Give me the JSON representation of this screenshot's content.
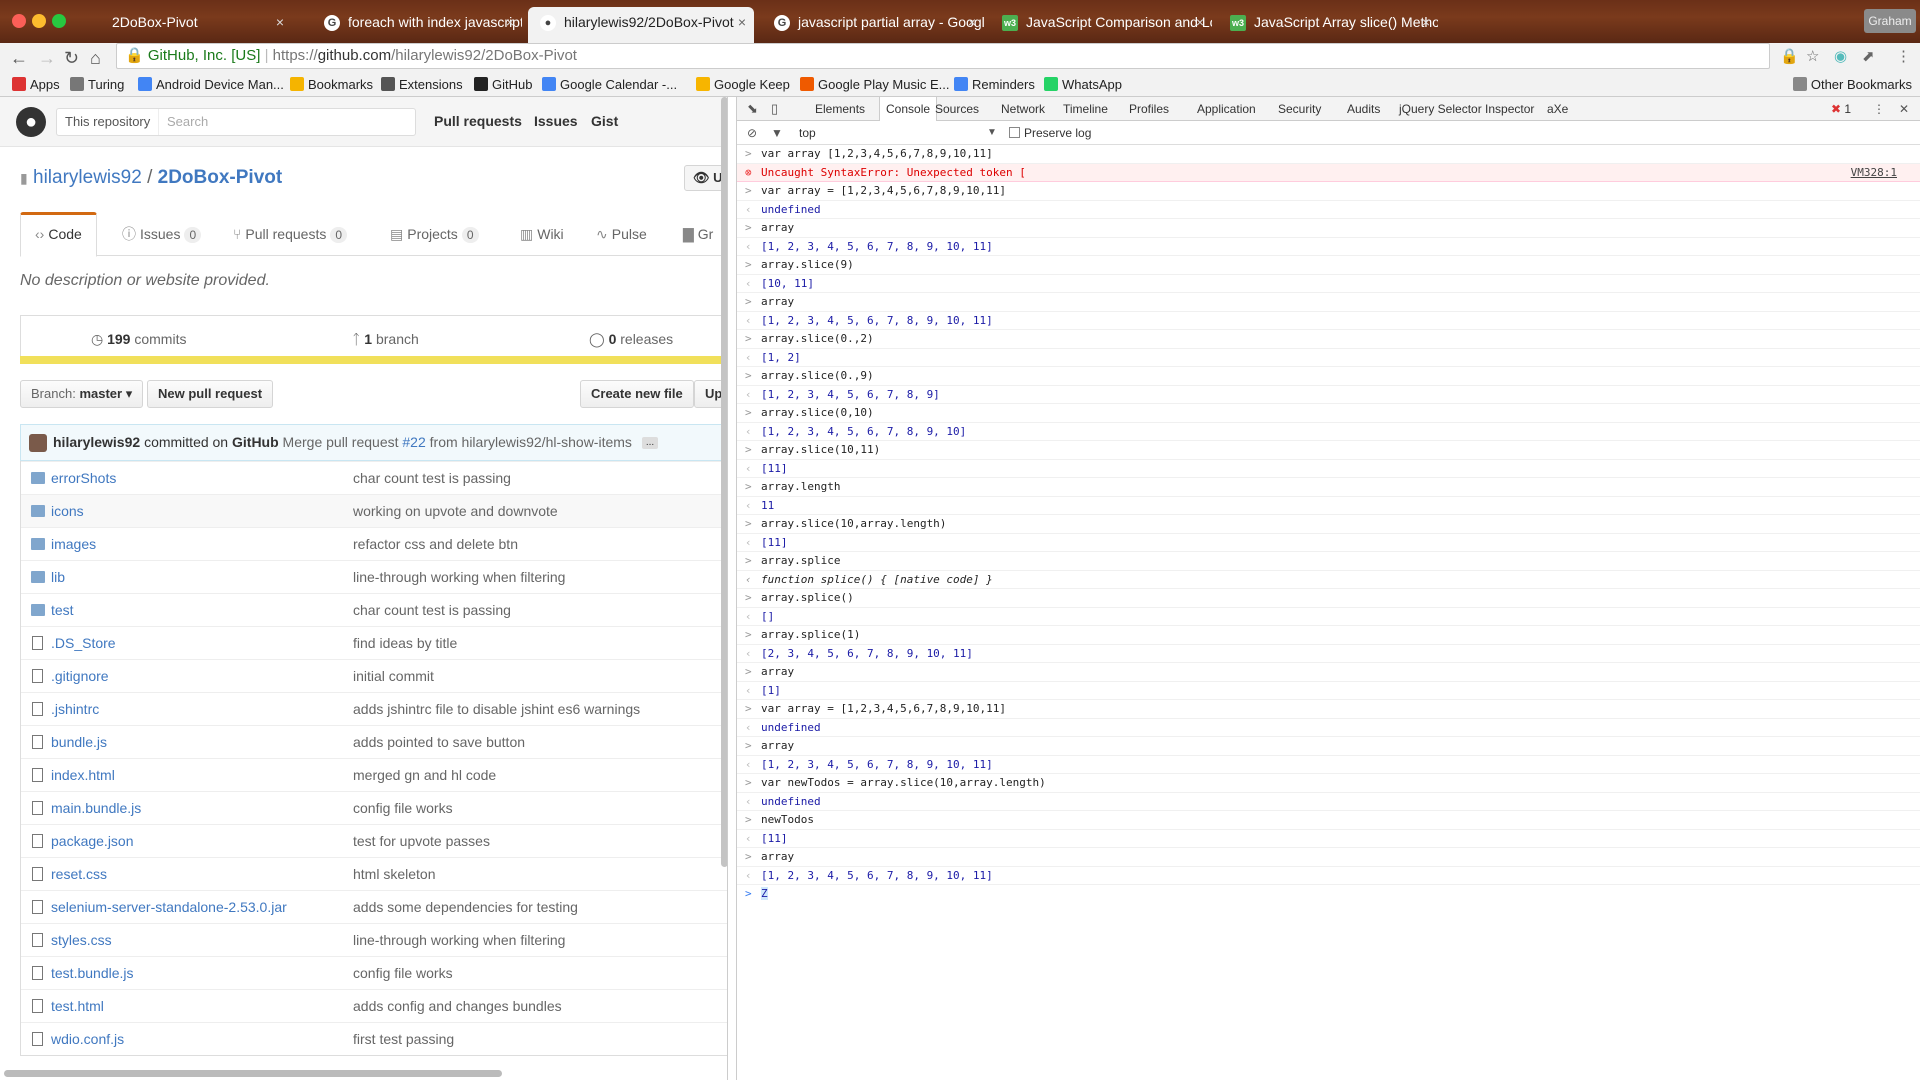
{
  "browser": {
    "tabs": [
      {
        "title": "2DoBox-Pivot",
        "icon": "blank",
        "active": false
      },
      {
        "title": "foreach with index javascript",
        "icon": "google",
        "active": false
      },
      {
        "title": "hilarylewis92/2DoBox-Pivot",
        "icon": "github",
        "active": true
      },
      {
        "title": "javascript partial array - Googl",
        "icon": "google",
        "active": false
      },
      {
        "title": "JavaScript Comparison and Lo",
        "icon": "w3",
        "active": false
      },
      {
        "title": "JavaScript Array slice() Metho",
        "icon": "w3",
        "active": false
      }
    ],
    "profile": "Graham",
    "address": {
      "security": "GitHub, Inc. [US]",
      "scheme": "https://",
      "host": "github.com",
      "path": "/hilarylewis92/2DoBox-Pivot"
    },
    "bookmarks": [
      {
        "label": "Apps",
        "color": "#d33"
      },
      {
        "label": "Turing",
        "color": "#777"
      },
      {
        "label": "Android Device Man...",
        "color": "#4285f4"
      },
      {
        "label": "Bookmarks",
        "color": "#f5b400"
      },
      {
        "label": "Extensions",
        "color": "#555"
      },
      {
        "label": "GitHub",
        "color": "#222"
      },
      {
        "label": "Google Calendar -...",
        "color": "#4285f4"
      },
      {
        "label": "Google Keep",
        "color": "#f7b500"
      },
      {
        "label": "Google Play Music E...",
        "color": "#ef5a00"
      },
      {
        "label": "Reminders",
        "color": "#4285f4"
      },
      {
        "label": "WhatsApp",
        "color": "#25d366"
      }
    ],
    "other_bookmarks": "Other Bookmarks"
  },
  "github": {
    "search_scope": "This repository",
    "search_placeholder": "Search",
    "nav": [
      "Pull requests",
      "Issues",
      "Gist"
    ],
    "owner": "hilarylewis92",
    "repo": "2DoBox-Pivot",
    "watch_label": "U",
    "tabs": [
      {
        "label": "Code",
        "count": null
      },
      {
        "label": "Issues",
        "count": "0"
      },
      {
        "label": "Pull requests",
        "count": "0"
      },
      {
        "label": "Projects",
        "count": "0"
      },
      {
        "label": "Wiki",
        "count": null
      },
      {
        "label": "Pulse",
        "count": null
      },
      {
        "label": "Gr",
        "count": null
      }
    ],
    "description": "No description or website provided.",
    "numbers": {
      "commits": "199",
      "commits_label": "commits",
      "branches": "1",
      "branches_label": "branch",
      "releases": "0",
      "releases_label": "releases"
    },
    "branch_label": "Branch:",
    "branch_value": "master",
    "new_pr": "New pull request",
    "create_file": "Create new file",
    "upload": "Up",
    "commit": {
      "author": "hilarylewis92",
      "action": "committed on",
      "via": "GitHub",
      "message": "Merge pull request",
      "pr": "#22",
      "from": "from hilarylewis92/hl-show-items",
      "ellipsis": "..."
    },
    "files": [
      {
        "name": "errorShots",
        "type": "dir",
        "message": "char count test is passing"
      },
      {
        "name": "icons",
        "type": "dir",
        "message": "working on upvote and downvote"
      },
      {
        "name": "images",
        "type": "dir",
        "message": "refactor css and delete btn"
      },
      {
        "name": "lib",
        "type": "dir",
        "message": "line-through working when filtering"
      },
      {
        "name": "test",
        "type": "dir",
        "message": "char count test is passing"
      },
      {
        "name": ".DS_Store",
        "type": "file",
        "message": "find ideas by title"
      },
      {
        "name": ".gitignore",
        "type": "file",
        "message": "initial commit"
      },
      {
        "name": ".jshintrc",
        "type": "file",
        "message": "adds jshintrc file to disable jshint es6 warnings"
      },
      {
        "name": "bundle.js",
        "type": "file",
        "message": "adds pointed to save button"
      },
      {
        "name": "index.html",
        "type": "file",
        "message": "merged gn and hl code"
      },
      {
        "name": "main.bundle.js",
        "type": "file",
        "message": "config file works"
      },
      {
        "name": "package.json",
        "type": "file",
        "message": "test for upvote passes"
      },
      {
        "name": "reset.css",
        "type": "file",
        "message": "html skeleton"
      },
      {
        "name": "selenium-server-standalone-2.53.0.jar",
        "type": "file",
        "message": "adds some dependencies for testing"
      },
      {
        "name": "styles.css",
        "type": "file",
        "message": "line-through working when filtering"
      },
      {
        "name": "test.bundle.js",
        "type": "file",
        "message": "config file works"
      },
      {
        "name": "test.html",
        "type": "file",
        "message": "adds config and changes bundles"
      },
      {
        "name": "wdio.conf.js",
        "type": "file",
        "message": "first test passing"
      }
    ]
  },
  "devtools": {
    "tabs": [
      "Elements",
      "Console",
      "Sources",
      "Network",
      "Timeline",
      "Profiles",
      "Application",
      "Security",
      "Audits",
      "jQuery Selector Inspector",
      "aXe"
    ],
    "active_tab": "Console",
    "error_count": "1",
    "context": "top",
    "preserve_log": "Preserve log",
    "lines": [
      {
        "kind": "in",
        "text": "var array [1,2,3,4,5,6,7,8,9,10,11]"
      },
      {
        "kind": "err",
        "text": "Uncaught SyntaxError: Unexpected token [",
        "source": "VM328:1"
      },
      {
        "kind": "in",
        "text": "var array = [1,2,3,4,5,6,7,8,9,10,11]"
      },
      {
        "kind": "out",
        "text": "undefined"
      },
      {
        "kind": "in",
        "text": "array"
      },
      {
        "kind": "out",
        "text": "[1, 2, 3, 4, 5, 6, 7, 8, 9, 10, 11]"
      },
      {
        "kind": "in",
        "text": "array.slice(9)"
      },
      {
        "kind": "out",
        "text": "[10, 11]"
      },
      {
        "kind": "in",
        "text": "array"
      },
      {
        "kind": "out",
        "text": "[1, 2, 3, 4, 5, 6, 7, 8, 9, 10, 11]"
      },
      {
        "kind": "in",
        "text": "array.slice(0.,2)"
      },
      {
        "kind": "out",
        "text": "[1, 2]"
      },
      {
        "kind": "in",
        "text": "array.slice(0.,9)"
      },
      {
        "kind": "out",
        "text": "[1, 2, 3, 4, 5, 6, 7, 8, 9]"
      },
      {
        "kind": "in",
        "text": "array.slice(0,10)"
      },
      {
        "kind": "out",
        "text": "[1, 2, 3, 4, 5, 6, 7, 8, 9, 10]"
      },
      {
        "kind": "in",
        "text": "array.slice(10,11)"
      },
      {
        "kind": "out",
        "text": "[11]"
      },
      {
        "kind": "in",
        "text": "array.length"
      },
      {
        "kind": "out",
        "text": "11"
      },
      {
        "kind": "in",
        "text": "array.slice(10,array.length)"
      },
      {
        "kind": "out",
        "text": "[11]"
      },
      {
        "kind": "in",
        "text": "array.splice"
      },
      {
        "kind": "fn",
        "text": "function splice() { [native code] }"
      },
      {
        "kind": "in",
        "text": "array.splice()"
      },
      {
        "kind": "out",
        "text": "[]"
      },
      {
        "kind": "in",
        "text": "array.splice(1)"
      },
      {
        "kind": "out",
        "text": "[2, 3, 4, 5, 6, 7, 8, 9, 10, 11]"
      },
      {
        "kind": "in",
        "text": "array"
      },
      {
        "kind": "out",
        "text": "[1]"
      },
      {
        "kind": "in",
        "text": "var array = [1,2,3,4,5,6,7,8,9,10,11]"
      },
      {
        "kind": "out",
        "text": "undefined"
      },
      {
        "kind": "in",
        "text": "array"
      },
      {
        "kind": "out",
        "text": "[1, 2, 3, 4, 5, 6, 7, 8, 9, 10, 11]"
      },
      {
        "kind": "in",
        "text": "var newTodos = array.slice(10,array.length)"
      },
      {
        "kind": "out",
        "text": "undefined"
      },
      {
        "kind": "in",
        "text": "newTodos"
      },
      {
        "kind": "out",
        "text": "[11]"
      },
      {
        "kind": "in",
        "text": "array"
      },
      {
        "kind": "out",
        "text": "[1, 2, 3, 4, 5, 6, 7, 8, 9, 10, 11]"
      }
    ],
    "prompt_value": "Z"
  }
}
